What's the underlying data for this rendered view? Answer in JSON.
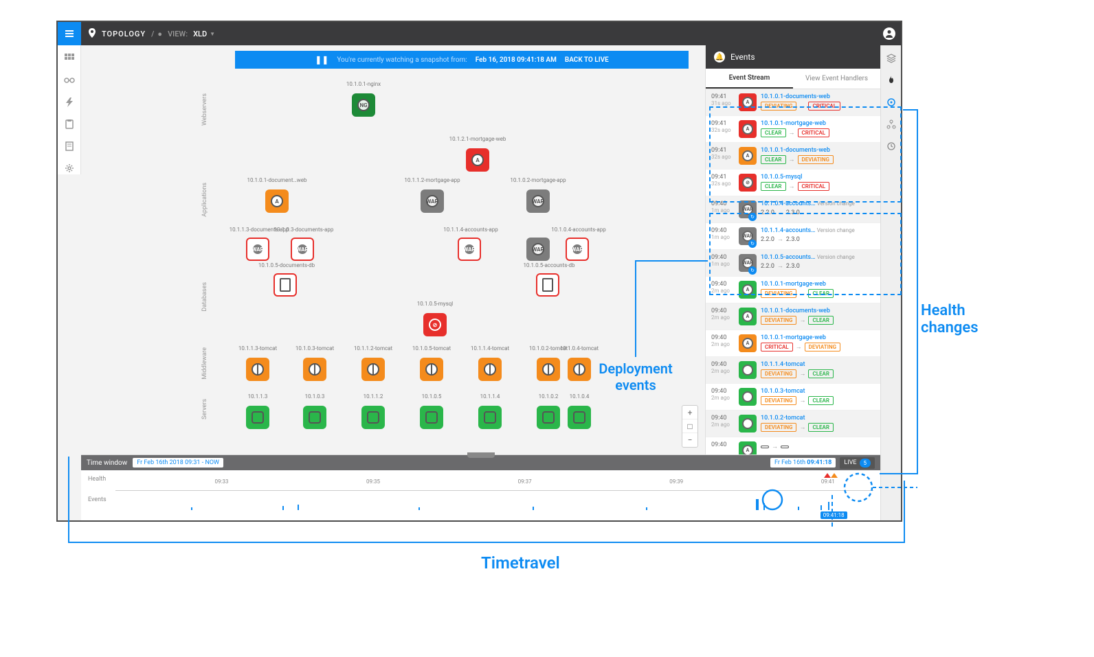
{
  "topbar": {
    "section": "TOPOLOGY",
    "sep": "/",
    "viewLabel": "VIEW:",
    "viewName": "XLD"
  },
  "ribbon": {
    "msg": "You're currently watching a snapshot from:",
    "timestamp": "Feb 16, 2018 09:41:18 AM",
    "back": "BACK TO LIVE"
  },
  "layers": [
    "Webservers",
    "Applications",
    "Databases",
    "Middleware",
    "Servers"
  ],
  "nodes": {
    "nginx": "10.1.0.1-nginx",
    "docweb": "10.1.0.1-document…web",
    "mortweb": "10.1.2.1-mortgage-web",
    "docapp1": "10.1.1.3-documents-app",
    "docapp2": "10.1.0.3-documents-app",
    "mortapp": "10.1.1.2-mortgage-app",
    "acctapp1": "10.1.1.4-accounts-app",
    "mortapp2": "10.1.0.2-mortgage-app",
    "acctapp2": "10.1.0.4-accounts-app",
    "docdb": "10.1.0.5-documents-db",
    "acctdb": "10.1.0.5-accounts-db",
    "mysql": "10.1.0.5-mysql",
    "tc1": "10.1.1.3-tomcat",
    "tc2": "10.1.0.3-tomcat",
    "tc3": "10.1.1.2-tomcat",
    "tc4": "10.1.0.5-tomcat",
    "tc5": "10.1.1.4-tomcat",
    "tc6": "10.1.0.2-tomcat",
    "tc7": "10.1.0.4-tomcat",
    "s1": "10.1.1.3",
    "s2": "10.1.0.3",
    "s3": "10.1.1.2",
    "s4": "10.1.0.5",
    "s5": "10.1.1.4",
    "s6": "10.1.0.2",
    "s7": "10.1.0.4"
  },
  "events": {
    "title": "Events",
    "tab1": "Event Stream",
    "tab2": "View Event Handlers",
    "rows": [
      {
        "t": "09:41",
        "ago": "31s ago",
        "ico": "red",
        "iconType": "A",
        "title": "10.1.0.1-documents-web",
        "from": "DEVIATING",
        "fromC": "b-orange",
        "to": "CRITICAL",
        "toC": "b-red",
        "alt": true
      },
      {
        "t": "09:41",
        "ago": "32s ago",
        "ico": "red",
        "iconType": "A",
        "title": "10.1.0.1-mortgage-web",
        "from": "CLEAR",
        "fromC": "b-green",
        "to": "CRITICAL",
        "toC": "b-red"
      },
      {
        "t": "09:41",
        "ago": "32s ago",
        "ico": "orange",
        "iconType": "A",
        "title": "10.1.0.1-documents-web",
        "from": "CLEAR",
        "fromC": "b-green",
        "to": "DEVIATING",
        "toC": "b-orange",
        "alt": true
      },
      {
        "t": "09:41",
        "ago": "32s ago",
        "ico": "red",
        "iconType": "DB",
        "title": "10.1.0.5-mysql",
        "from": "CLEAR",
        "fromC": "b-green",
        "to": "CRITICAL",
        "toC": "b-red"
      },
      {
        "t": "09:40",
        "ago": "1m ago",
        "ico": "grey",
        "iconType": "WAR",
        "title": "10.1.0.4-accounts…",
        "version": true,
        "vfrom": "2.2.0",
        "vto": "2.3.0",
        "alt": true,
        "sync": true,
        "vlabel": "Version change"
      },
      {
        "t": "09:40",
        "ago": "1m ago",
        "ico": "grey",
        "iconType": "WAR",
        "title": "10.1.1.4-accounts…",
        "version": true,
        "vfrom": "2.2.0",
        "vto": "2.3.0",
        "sync": true,
        "vlabel": "Version change"
      },
      {
        "t": "09:40",
        "ago": "1m ago",
        "ico": "grey",
        "iconType": "WAR",
        "title": "10.1.0.5-accounts…",
        "version": true,
        "vfrom": "2.2.0",
        "vto": "2.3.0",
        "alt": true,
        "sync": true,
        "vlabel": "Version change"
      },
      {
        "t": "09:40",
        "ago": "2m ago",
        "ico": "green",
        "iconType": "A",
        "title": "10.1.0.1-mortgage-web",
        "from": "DEVIATING",
        "fromC": "b-orange",
        "to": "CLEAR",
        "toC": "b-green"
      },
      {
        "t": "09:40",
        "ago": "2m ago",
        "ico": "green",
        "iconType": "A",
        "title": "10.1.0.1-documents-web",
        "from": "DEVIATING",
        "fromC": "b-orange",
        "to": "CLEAR",
        "toC": "b-green",
        "alt": true
      },
      {
        "t": "09:40",
        "ago": "2m ago",
        "ico": "orange",
        "iconType": "A",
        "title": "10.1.0.1-mortgage-web",
        "from": "CRITICAL",
        "fromC": "b-red",
        "to": "DEVIATING",
        "toC": "b-orange"
      },
      {
        "t": "09:40",
        "ago": "2m ago",
        "ico": "green",
        "iconType": "G",
        "title": "10.1.1.4-tomcat",
        "from": "DEVIATING",
        "fromC": "b-orange",
        "to": "CLEAR",
        "toC": "b-green",
        "alt": true
      },
      {
        "t": "09:40",
        "ago": "2m ago",
        "ico": "green",
        "iconType": "G",
        "title": "10.1.0.3-tomcat",
        "from": "DEVIATING",
        "fromC": "b-orange",
        "to": "CLEAR",
        "toC": "b-green"
      },
      {
        "t": "09:40",
        "ago": "2m ago",
        "ico": "green",
        "iconType": "G",
        "title": "10.1.0.2-tomcat",
        "from": "DEVIATING",
        "fromC": "b-orange",
        "to": "CLEAR",
        "toC": "b-green",
        "alt": true
      },
      {
        "t": "09:40",
        "ago": "",
        "ico": "green",
        "iconType": "A",
        "title": "",
        "from": "",
        "to": ""
      }
    ]
  },
  "timeline": {
    "label": "Time window",
    "range": "Fr Feb 16th 2018 09:31 - NOW",
    "currentDate": "Fr Feb 16th",
    "currentTime": "09:41:18",
    "live": "LIVE",
    "liveCount": "5",
    "rowHealth": "Health",
    "rowEvents": "Events",
    "ticks": [
      "09:33",
      "09:35",
      "09:37",
      "09:39",
      "09:41"
    ],
    "flag": "09:41:18"
  },
  "annotations": {
    "deploy": "Deployment events",
    "health": "Health changes",
    "timetravel": "Timetravel"
  }
}
